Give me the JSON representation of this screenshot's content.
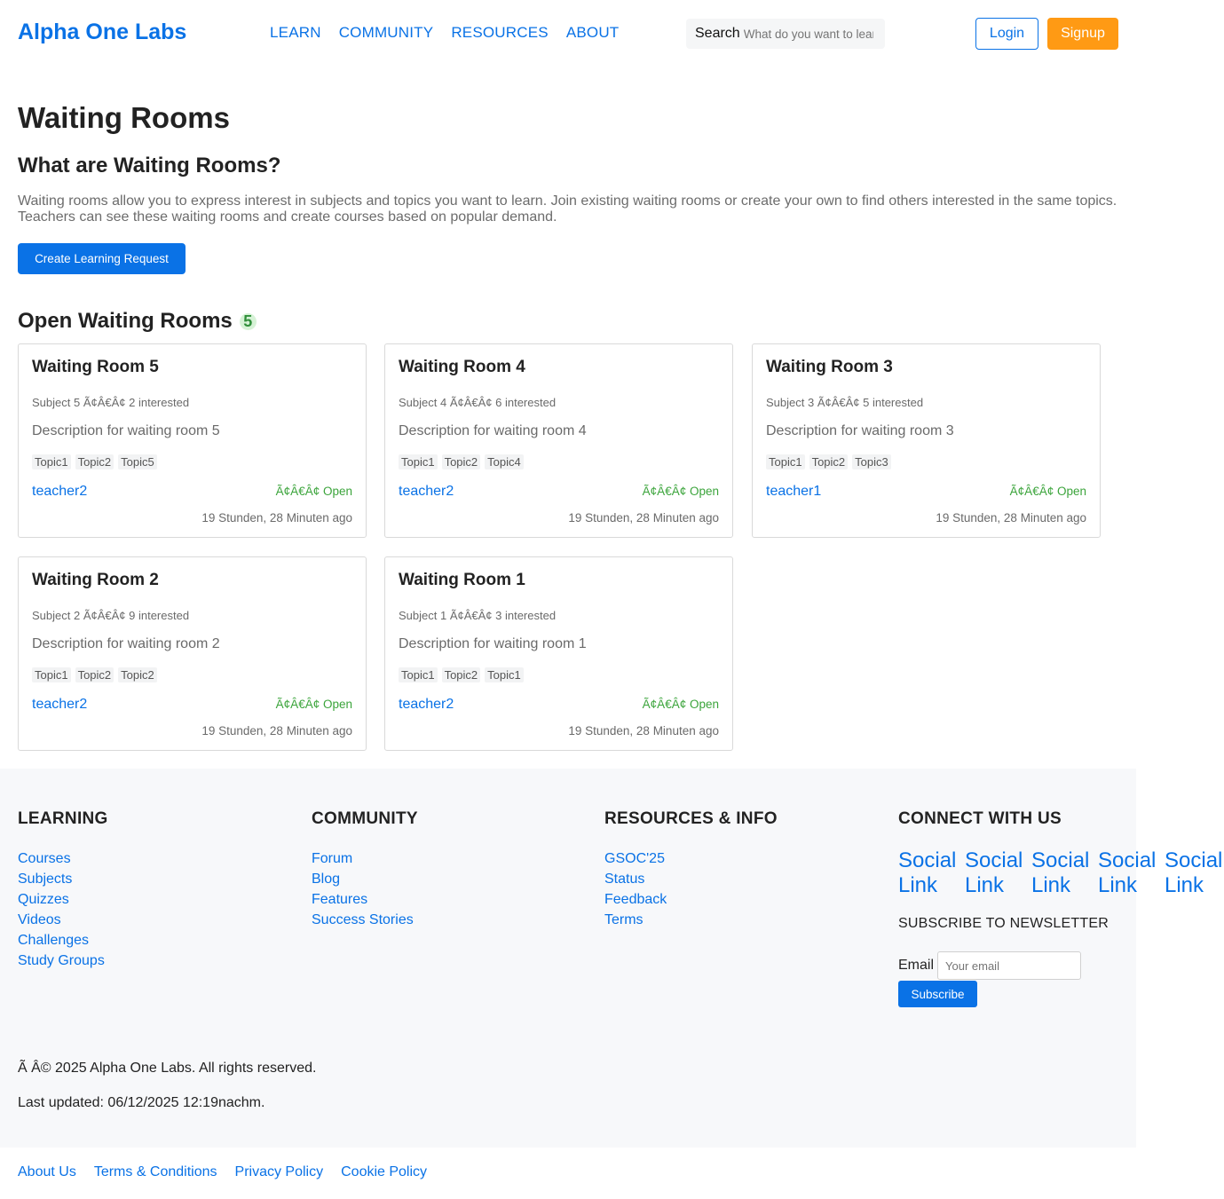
{
  "header": {
    "brand": "Alpha One Labs",
    "nav": [
      "LEARN",
      "COMMUNITY",
      "RESOURCES",
      "ABOUT"
    ],
    "search_label": "Search",
    "search_placeholder": "What do you want to learn?",
    "login": "Login",
    "signup": "Signup"
  },
  "main": {
    "title": "Waiting Rooms",
    "section_title": "What are Waiting Rooms?",
    "intro": "Waiting rooms allow you to express interest in subjects and topics you want to learn. Join existing waiting rooms or create your own to find others interested in the same topics. Teachers can see these waiting rooms and create courses based on popular demand.",
    "create_button": "Create Learning Request",
    "open_title": "Open Waiting Rooms",
    "open_count": "5"
  },
  "rooms": [
    {
      "title": "Waiting Room 5",
      "meta": "Subject 5 Ã¢Â€Â¢ 2 interested",
      "desc": "Description for waiting room 5",
      "tags": [
        "Topic1",
        "Topic2",
        "Topic5"
      ],
      "teacher": "teacher2",
      "status": "Ã¢Â€Â¢ Open",
      "time": "19 Stunden, 28 Minuten ago"
    },
    {
      "title": "Waiting Room 4",
      "meta": "Subject 4 Ã¢Â€Â¢ 6 interested",
      "desc": "Description for waiting room 4",
      "tags": [
        "Topic1",
        "Topic2",
        "Topic4"
      ],
      "teacher": "teacher2",
      "status": "Ã¢Â€Â¢ Open",
      "time": "19 Stunden, 28 Minuten ago"
    },
    {
      "title": "Waiting Room 3",
      "meta": "Subject 3 Ã¢Â€Â¢ 5 interested",
      "desc": "Description for waiting room 3",
      "tags": [
        "Topic1",
        "Topic2",
        "Topic3"
      ],
      "teacher": "teacher1",
      "status": "Ã¢Â€Â¢ Open",
      "time": "19 Stunden, 28 Minuten ago"
    },
    {
      "title": "Waiting Room 2",
      "meta": "Subject 2 Ã¢Â€Â¢ 9 interested",
      "desc": "Description for waiting room 2",
      "tags": [
        "Topic1",
        "Topic2",
        "Topic2"
      ],
      "teacher": "teacher2",
      "status": "Ã¢Â€Â¢ Open",
      "time": "19 Stunden, 28 Minuten ago"
    },
    {
      "title": "Waiting Room 1",
      "meta": "Subject 1 Ã¢Â€Â¢ 3 interested",
      "desc": "Description for waiting room 1",
      "tags": [
        "Topic1",
        "Topic2",
        "Topic1"
      ],
      "teacher": "teacher2",
      "status": "Ã¢Â€Â¢ Open",
      "time": "19 Stunden, 28 Minuten ago"
    }
  ],
  "footer": {
    "learning": {
      "title": "LEARNING",
      "links": [
        "Courses",
        "Subjects",
        "Quizzes",
        "Videos",
        "Challenges",
        "Study Groups"
      ]
    },
    "community": {
      "title": "COMMUNITY",
      "links": [
        "Forum",
        "Blog",
        "Features",
        "Success Stories"
      ]
    },
    "resources": {
      "title": "RESOURCES & INFO",
      "links": [
        "GSOC'25",
        "Status",
        "Feedback",
        "Terms"
      ]
    },
    "connect": {
      "title": "CONNECT WITH US",
      "social": [
        "Social Link",
        "Social Link",
        "Social Link",
        "Social Link",
        "Social Link"
      ],
      "newsletter_title": "SUBSCRIBE TO NEWSLETTER",
      "email_label": "Email",
      "email_placeholder": "Your email",
      "subscribe": "Subscribe"
    },
    "copyright": "Ã   Â© 2025 Alpha One Labs. All rights reserved.",
    "updated": "Last updated: 06/12/2025 12:19nachm."
  },
  "bottom_links": [
    "About Us",
    "Terms & Conditions",
    "Privacy Policy",
    "Cookie Policy"
  ],
  "colors": {
    "accent": "#0a72e6",
    "signup": "#ff9a14",
    "open": "#3ba43b"
  }
}
